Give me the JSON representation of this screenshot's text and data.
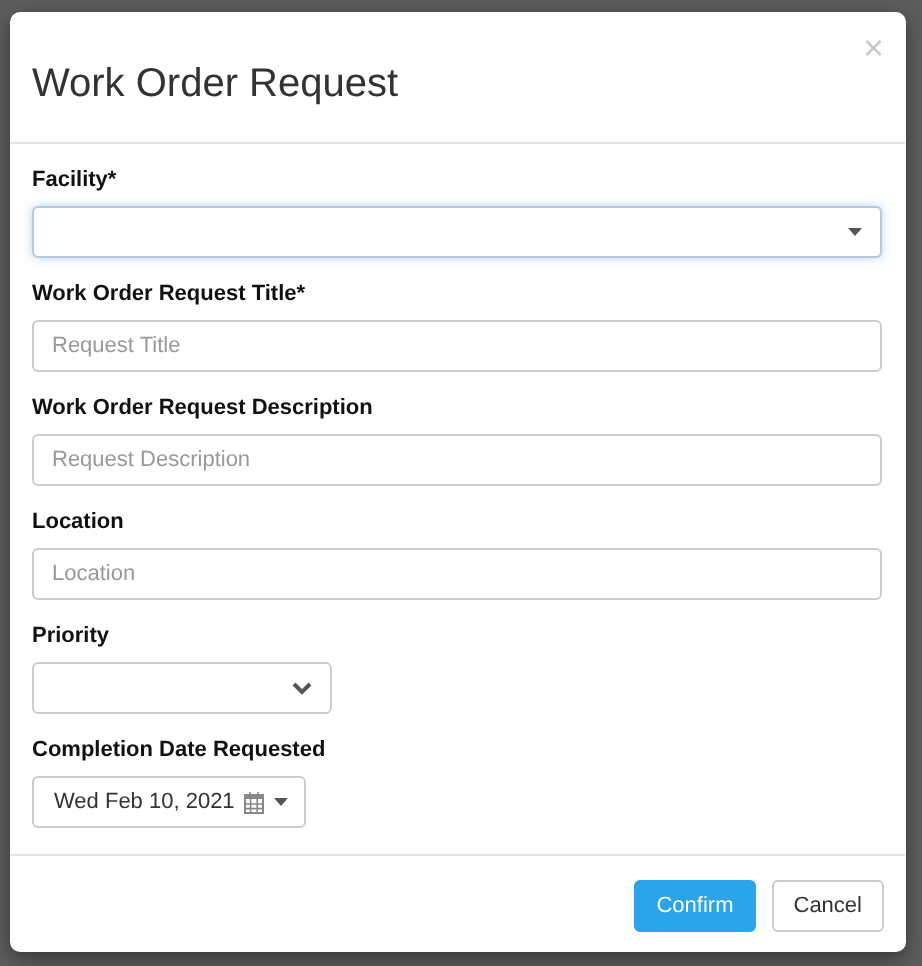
{
  "dialog": {
    "title": "Work Order Request",
    "close": "×",
    "fields": [
      {
        "kind": "dropdown",
        "label": "Facility*",
        "focused": true
      },
      {
        "kind": "text",
        "label": "Work Order Request Title*",
        "placeholder": "Request Title"
      },
      {
        "kind": "text",
        "label": "Work Order Request Description",
        "placeholder": "Request Description"
      },
      {
        "kind": "text",
        "label": "Location",
        "placeholder": "Location"
      },
      {
        "kind": "select",
        "label": "Priority"
      },
      {
        "kind": "date",
        "label": "Completion Date Requested",
        "value": "Wed Feb 10, 2021"
      }
    ],
    "buttons": [
      {
        "label": "Confirm",
        "primary": true
      },
      {
        "label": "Cancel",
        "primary": false
      }
    ]
  }
}
